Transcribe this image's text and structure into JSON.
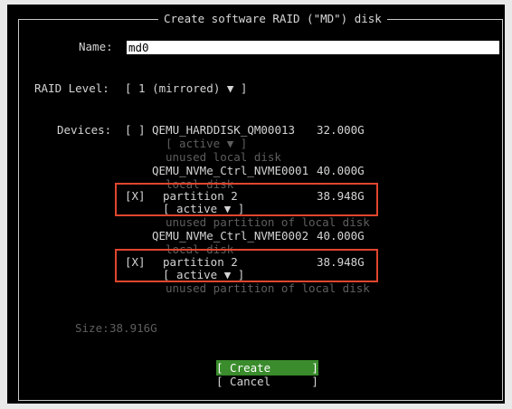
{
  "dialog": {
    "title": "Create software RAID (\"MD\") disk"
  },
  "form": {
    "name_label": "Name:",
    "name_value": "md0",
    "raid_label": "RAID Level:",
    "raid_value": "[ 1 (mirrored) ▼ ]",
    "devices_label": "Devices:",
    "size_label": "Size:",
    "size_value": "38.916G"
  },
  "devices": [
    {
      "check": "[ ]",
      "name": "QEMU_HARDDISK_QM00013",
      "size": "32.000G",
      "role": "[ active ▼ ]",
      "desc": "unused local disk"
    },
    {
      "name": "QEMU_NVMe_Ctrl_NVME0001",
      "size": "40.000G",
      "desc": "local disk"
    },
    {
      "check": "[X]",
      "name": "partition 2",
      "size": "38.948G",
      "role": "[ active ▼ ]",
      "desc": "unused partition of local disk"
    },
    {
      "name": "QEMU_NVMe_Ctrl_NVME0002",
      "size": "40.000G",
      "desc": "local disk"
    },
    {
      "check": "[X]",
      "name": "partition 2",
      "size": "38.948G",
      "role": "[ active ▼ ]",
      "desc": "unused partition of local disk"
    }
  ],
  "buttons": {
    "create": "[ Create      ]",
    "cancel": "[ Cancel      ]"
  },
  "colors": {
    "highlight": "#e0462e",
    "create_bg": "#3a8c2c"
  }
}
